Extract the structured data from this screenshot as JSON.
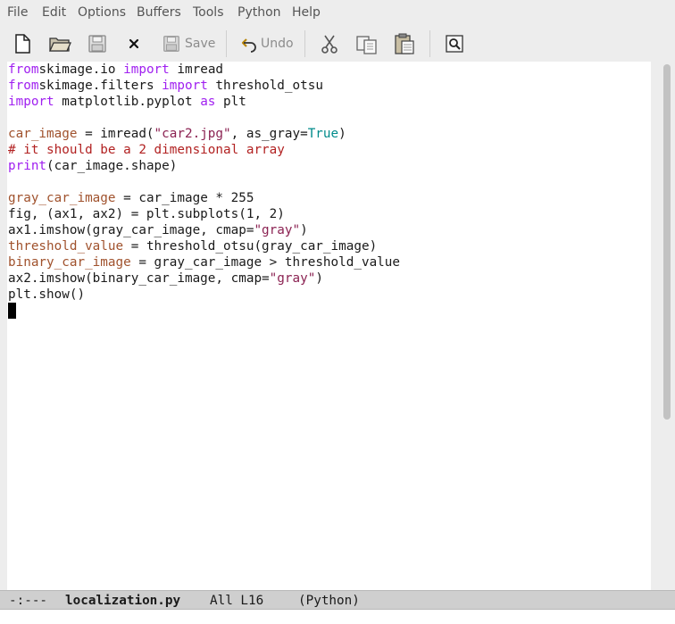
{
  "menu": [
    "File",
    "Edit",
    "Options",
    "Buffers",
    "Tools",
    "Python",
    "Help"
  ],
  "toolbar": {
    "save_label": "Save",
    "undo_label": "Undo"
  },
  "code_lines": [
    [
      [
        "kw",
        "from"
      ],
      [
        "",
        "skimage.io "
      ],
      [
        "kw",
        "import"
      ],
      [
        "",
        " imread"
      ]
    ],
    [
      [
        "kw",
        "from"
      ],
      [
        "",
        "skimage.filters "
      ],
      [
        "kw",
        "import"
      ],
      [
        "",
        " threshold_otsu"
      ]
    ],
    [
      [
        "kw",
        "import"
      ],
      [
        "",
        " matplotlib.pyplot "
      ],
      [
        "kw",
        "as"
      ],
      [
        "",
        " plt"
      ]
    ],
    [],
    [
      [
        "var",
        "car_image"
      ],
      [
        "",
        " = imread("
      ],
      [
        "str",
        "\"car2.jpg\""
      ],
      [
        "",
        ", as_gray="
      ],
      [
        "cst",
        "True"
      ],
      [
        "",
        ")"
      ]
    ],
    [
      [
        "cm",
        "# it should be a 2 dimensional array"
      ]
    ],
    [
      [
        "bi",
        "print"
      ],
      [
        "",
        "(car_image.shape)"
      ]
    ],
    [],
    [
      [
        "var",
        "gray_car_image"
      ],
      [
        "",
        " = car_image * 255"
      ]
    ],
    [
      [
        "",
        "fig, (ax1, ax2) = plt.subplots(1, 2)"
      ]
    ],
    [
      [
        "",
        "ax1.imshow(gray_car_image, cmap="
      ],
      [
        "str",
        "\"gray\""
      ],
      [
        "",
        ")"
      ]
    ],
    [
      [
        "var",
        "threshold_value"
      ],
      [
        "",
        " = threshold_otsu(gray_car_image)"
      ]
    ],
    [
      [
        "var",
        "binary_car_image"
      ],
      [
        "",
        " = gray_car_image > threshold_value"
      ]
    ],
    [
      [
        "",
        "ax2.imshow(binary_car_image, cmap="
      ],
      [
        "str",
        "\"gray\""
      ],
      [
        "",
        ")"
      ]
    ],
    [
      [
        "",
        "plt.show()"
      ]
    ],
    []
  ],
  "modeline": {
    "status": "-:---",
    "buffer_name": "localization.py",
    "position": "All L16",
    "mode": "(Python)"
  }
}
